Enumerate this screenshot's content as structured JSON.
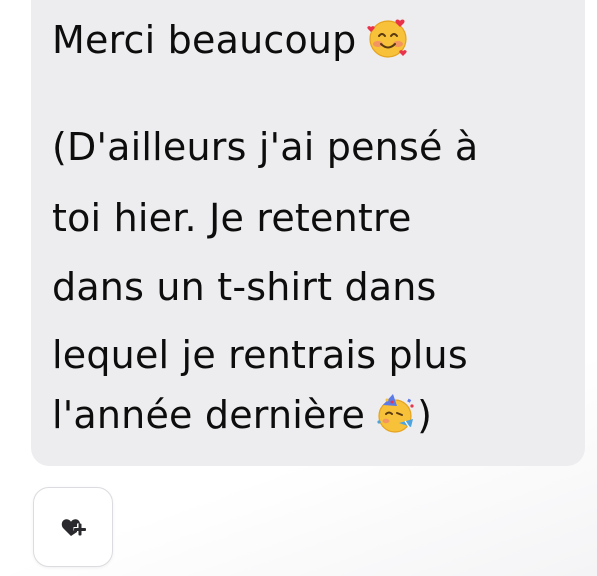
{
  "message": {
    "lines": [
      "Merci beaucoup",
      "(D'ailleurs j'ai pensé à",
      "toi hier. Je retentre",
      "dans un t-shirt dans",
      "lequel je rentrais plus",
      "l'année dernière",
      ")"
    ],
    "emojis": [
      "smiling-face-with-hearts",
      "partying-face"
    ]
  },
  "reaction_button": {
    "icon": "heart-plus-icon"
  },
  "colors": {
    "bubble": "#ededef",
    "text": "#0d0d0d"
  }
}
